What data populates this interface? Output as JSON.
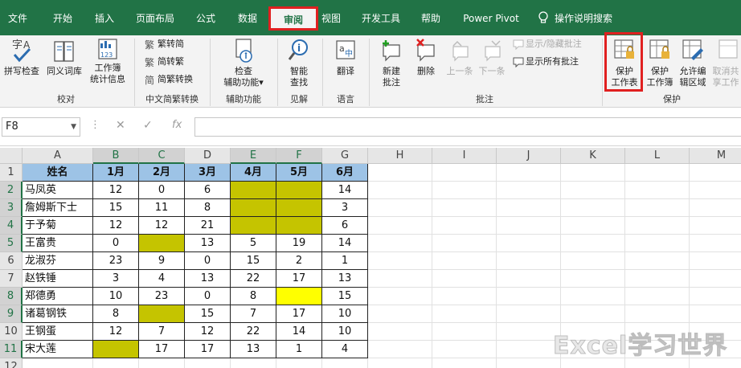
{
  "tabs": [
    {
      "id": "file",
      "label": "文件"
    },
    {
      "id": "home",
      "label": "开始"
    },
    {
      "id": "insert",
      "label": "插入"
    },
    {
      "id": "layout",
      "label": "页面布局"
    },
    {
      "id": "formulas",
      "label": "公式"
    },
    {
      "id": "data",
      "label": "数据"
    },
    {
      "id": "review",
      "label": "审阅"
    },
    {
      "id": "view",
      "label": "视图"
    },
    {
      "id": "developer",
      "label": "开发工具"
    },
    {
      "id": "help",
      "label": "帮助"
    },
    {
      "id": "powerpivot",
      "label": "Power Pivot"
    }
  ],
  "tell_me": {
    "label": "操作说明搜索",
    "icon": "lightbulb-icon"
  },
  "ribbon": {
    "proofing": {
      "group_label": "校对",
      "spelling": {
        "label": "拼写检查",
        "icon": "spell-check-icon"
      },
      "thesaurus": {
        "label": "同义词库",
        "icon": "thesaurus-icon"
      },
      "stats": {
        "label1": "工作簿",
        "label2": "统计信息",
        "icon": "workbook-stats-icon"
      }
    },
    "chinese": {
      "group_label": "中文简繁转换",
      "to_simplified": "繁转简",
      "to_traditional": "简转繁",
      "convert": "简繁转换"
    },
    "accessibility": {
      "group_label": "辅助功能",
      "check": {
        "label1": "检查",
        "label2": "辅助功能",
        "arrow": "▾"
      }
    },
    "insights": {
      "group_label": "见解",
      "smart_lookup": {
        "label1": "智能",
        "label2": "查找"
      }
    },
    "language": {
      "group_label": "语言",
      "translate": {
        "label": "翻译"
      }
    },
    "comments": {
      "group_label": "批注",
      "new_comment": {
        "label1": "新建",
        "label2": "批注"
      },
      "delete": {
        "label": "删除"
      },
      "previous": {
        "label": "上一条"
      },
      "next": {
        "label": "下一条"
      },
      "show_hide": "显示/隐藏批注",
      "show_all": "显示所有批注"
    },
    "protect": {
      "group_label": "保护",
      "protect_sheet": {
        "label1": "保护",
        "label2": "工作表"
      },
      "protect_workbook": {
        "label1": "保护",
        "label2": "工作簿"
      },
      "allow_edit": {
        "label1": "允许编",
        "label2": "辑区域"
      },
      "unshare": {
        "label1": "取消共",
        "label2": "享工作"
      }
    }
  },
  "formula_bar": {
    "name_box": "F8",
    "dots": "⋮",
    "cancel": "✕",
    "enter": "✓",
    "fx": "fx",
    "value": ""
  },
  "columns": [
    "A",
    "B",
    "C",
    "D",
    "E",
    "F",
    "G",
    "H",
    "I",
    "J",
    "K",
    "L",
    "M"
  ],
  "rows": [
    "1",
    "2",
    "3",
    "4",
    "5",
    "6",
    "7",
    "8",
    "9",
    "10",
    "11",
    "12"
  ],
  "table": {
    "header": [
      "姓名",
      "1月",
      "2月",
      "3月",
      "4月",
      "5月",
      "6月"
    ],
    "rows": [
      {
        "name": "马凤英",
        "values": [
          "12",
          "0",
          "6",
          "",
          "",
          "14"
        ],
        "fill": [
          "",
          "",
          "",
          "olive",
          "olive",
          ""
        ]
      },
      {
        "name": "詹姆斯下士",
        "values": [
          "15",
          "11",
          "8",
          "",
          "",
          "3"
        ],
        "fill": [
          "",
          "",
          "",
          "olive",
          "olive",
          ""
        ]
      },
      {
        "name": "于予菊",
        "values": [
          "12",
          "12",
          "21",
          "",
          "",
          "6"
        ],
        "fill": [
          "",
          "",
          "",
          "olive",
          "olive",
          ""
        ]
      },
      {
        "name": "王富贵",
        "values": [
          "0",
          "",
          "13",
          "5",
          "19",
          "14"
        ],
        "fill": [
          "",
          "olive",
          "",
          "",
          "",
          ""
        ]
      },
      {
        "name": "龙淑芬",
        "values": [
          "23",
          "9",
          "0",
          "15",
          "2",
          "1"
        ],
        "fill": [
          "",
          "",
          "",
          "",
          "",
          ""
        ]
      },
      {
        "name": "赵铁锤",
        "values": [
          "3",
          "4",
          "13",
          "22",
          "17",
          "13"
        ],
        "fill": [
          "",
          "",
          "",
          "",
          "",
          ""
        ]
      },
      {
        "name": "郑德勇",
        "values": [
          "10",
          "23",
          "0",
          "8",
          "",
          "15"
        ],
        "fill": [
          "",
          "",
          "",
          "",
          "yellow",
          ""
        ]
      },
      {
        "name": "诸葛钢铁",
        "values": [
          "8",
          "",
          "15",
          "7",
          "17",
          "10"
        ],
        "fill": [
          "",
          "olive",
          "",
          "",
          "",
          ""
        ]
      },
      {
        "name": "王钢蛋",
        "values": [
          "12",
          "7",
          "12",
          "22",
          "14",
          "10"
        ],
        "fill": [
          "",
          "",
          "",
          "",
          "",
          ""
        ]
      },
      {
        "name": "宋大莲",
        "values": [
          "",
          "17",
          "17",
          "13",
          "1",
          "4"
        ],
        "fill": [
          "olive",
          "",
          "",
          "",
          "",
          ""
        ]
      }
    ]
  },
  "watermark": "Excel学习世界",
  "colors": {
    "brand": "#217346",
    "highlight": "#e02020",
    "header_fill": "#9dc3e6",
    "olive_fill": "#c5c400",
    "yellow_fill": "#ffff00"
  }
}
